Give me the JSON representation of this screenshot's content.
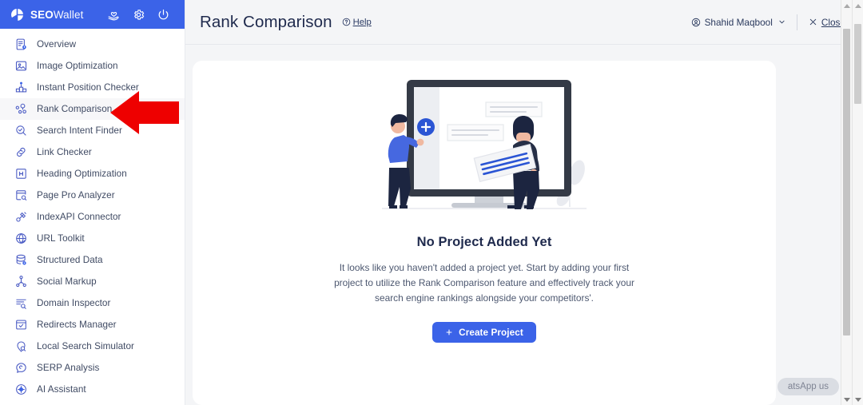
{
  "brand": {
    "seo": "SEO",
    "wallet": "Wallet",
    "logo_icon": "pie-chart-logo-icon",
    "header_icons": [
      {
        "name": "heart-in-hand-icon"
      },
      {
        "name": "gear-icon"
      },
      {
        "name": "power-icon"
      }
    ]
  },
  "sidebar": {
    "items": [
      {
        "label": "Overview",
        "icon": "document-badge-icon",
        "active": false
      },
      {
        "label": "Image Optimization",
        "icon": "image-icon",
        "active": false
      },
      {
        "label": "Instant Position Checker",
        "icon": "podium-icon",
        "active": false
      },
      {
        "label": "Rank Comparison",
        "icon": "nodes-compare-icon",
        "active": true
      },
      {
        "label": "Search Intent Finder",
        "icon": "search-check-icon",
        "active": false
      },
      {
        "label": "Link Checker",
        "icon": "link-icon",
        "active": false
      },
      {
        "label": "Heading Optimization",
        "icon": "heading-h-icon",
        "active": false
      },
      {
        "label": "Page Pro Analyzer",
        "icon": "page-magnifier-icon",
        "active": false
      },
      {
        "label": "IndexAPI Connector",
        "icon": "plug-connector-icon",
        "active": false
      },
      {
        "label": "URL Toolkit",
        "icon": "globe-check-icon",
        "active": false
      },
      {
        "label": "Structured Data",
        "icon": "database-gear-icon",
        "active": false
      },
      {
        "label": "Social Markup",
        "icon": "share-nodes-icon",
        "active": false
      },
      {
        "label": "Domain Inspector",
        "icon": "list-magnifier-icon",
        "active": false
      },
      {
        "label": "Redirects Manager",
        "icon": "window-check-icon",
        "active": false
      },
      {
        "label": "Local Search Simulator",
        "icon": "map-pin-search-icon",
        "active": false
      },
      {
        "label": "SERP Analysis",
        "icon": "speech-bubble-icon",
        "active": false
      },
      {
        "label": "AI Assistant",
        "icon": "robot-gear-icon",
        "active": false
      }
    ]
  },
  "topbar": {
    "title": "Rank Comparison",
    "help_label": "Help",
    "help_icon": "question-circle-icon",
    "user_name": "Shahid Maqbool",
    "user_icon": "user-circle-icon",
    "chevron_icon": "chevron-down-icon",
    "close_label": "Close",
    "close_icon": "close-x-icon"
  },
  "empty_state": {
    "illustration": "two-people-adding-project-to-monitor-illustration",
    "title": "No Project Added Yet",
    "description": "It looks like you haven't added a project yet. Start by adding your first project to utilize the Rank Comparison feature and effectively track your search engine rankings alongside your competitors'.",
    "button_label": "Create Project",
    "button_icon": "plus-icon"
  },
  "overlay": {
    "whatsapp_label": "atsApp us",
    "annotation_arrow": "red-left-pointing-arrow"
  },
  "colors": {
    "brand_blue": "#3b63e8",
    "page_bg": "#f4f5f7",
    "card_bg": "#ffffff",
    "text_dark": "#1f2a4d",
    "text_muted": "#4d5870",
    "annotation_red": "#ee0000"
  },
  "scrollbars": {
    "inner": "inner-content-scrollbar",
    "outer": "browser-scrollbar"
  }
}
